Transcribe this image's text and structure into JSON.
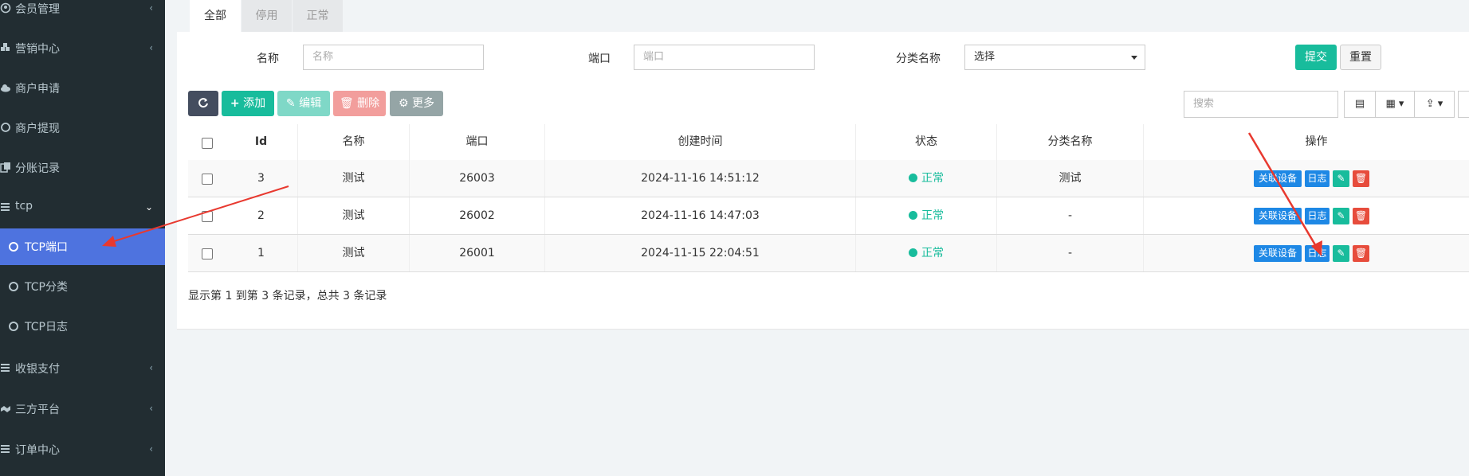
{
  "sidebar": {
    "items": [
      {
        "label": "会员管理",
        "chevron": "‹"
      },
      {
        "label": "营销中心",
        "chevron": "‹"
      },
      {
        "label": "商户申请"
      },
      {
        "label": "商户提现"
      },
      {
        "label": "分账记录"
      },
      {
        "label": "tcp",
        "chevron": "⌄"
      },
      {
        "label": "TCP端口"
      },
      {
        "label": "TCP分类"
      },
      {
        "label": "TCP日志"
      },
      {
        "label": "收银支付",
        "chevron": "‹"
      },
      {
        "label": "三方平台",
        "chevron": "‹"
      },
      {
        "label": "订单中心",
        "chevron": "‹"
      }
    ]
  },
  "tabs": [
    {
      "label": "全部"
    },
    {
      "label": "停用"
    },
    {
      "label": "正常"
    }
  ],
  "filter": {
    "name_label": "名称",
    "name_placeholder": "名称",
    "port_label": "端口",
    "port_placeholder": "端口",
    "category_label": "分类名称",
    "category_value": "选择",
    "submit": "提交",
    "reset": "重置"
  },
  "toolbar": {
    "add": "添加",
    "edit": "编辑",
    "delete": "删除",
    "more": "更多",
    "search_placeholder": "搜索"
  },
  "table": {
    "headers": [
      "Id",
      "名称",
      "端口",
      "创建时间",
      "状态",
      "分类名称",
      "操作"
    ],
    "rows": [
      {
        "id": "3",
        "name": "测试",
        "port": "26003",
        "created": "2024-11-16 14:51:12",
        "status": "正常",
        "category": "测试"
      },
      {
        "id": "2",
        "name": "测试",
        "port": "26002",
        "created": "2024-11-16 14:47:03",
        "status": "正常",
        "category": "-"
      },
      {
        "id": "1",
        "name": "测试",
        "port": "26001",
        "created": "2024-11-15 22:04:51",
        "status": "正常",
        "category": "-"
      }
    ],
    "action_labels": {
      "device": "关联设备",
      "log": "日志"
    }
  },
  "footer": {
    "summary": "显示第 1 到第 3 条记录，总共 3 条记录"
  },
  "colors": {
    "sidebar_bg": "#222d32",
    "active_item": "#4e73df",
    "success": "#18bc9c",
    "primary": "#1e88e5",
    "danger": "#e74c3c",
    "annotation_arrow": "#e8392f"
  }
}
